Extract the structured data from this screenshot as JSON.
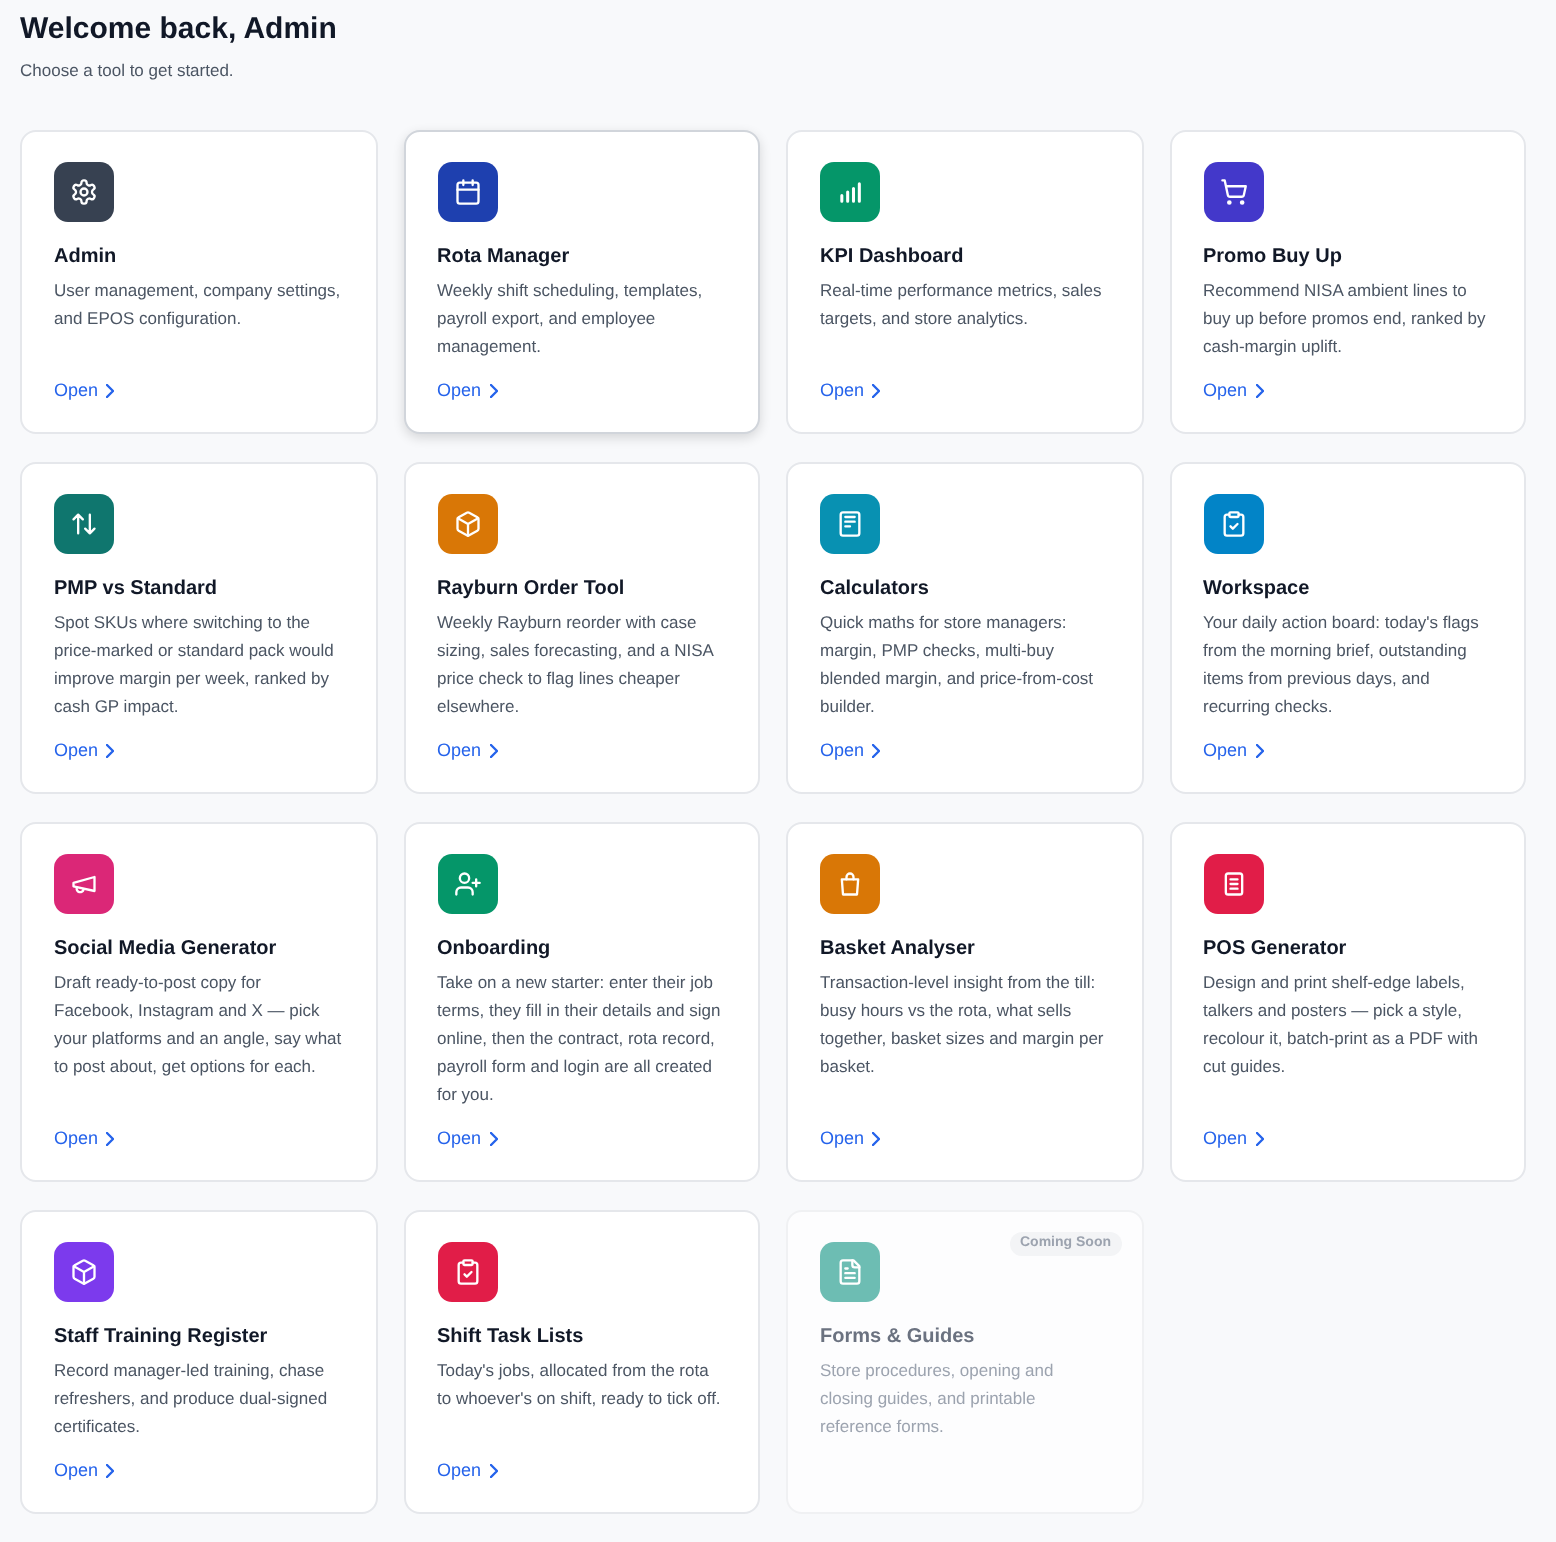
{
  "header": {
    "title": "Welcome back, Admin",
    "subtitle": "Choose a tool to get started."
  },
  "tools": [
    {
      "title": "Admin",
      "description": "User management, company settings, and EPOS configuration.",
      "link": "Open",
      "color": "#374151",
      "hovered": false,
      "disabled": false
    },
    {
      "title": "Rota Manager",
      "description": "Weekly shift scheduling, templates, payroll export, and employee management.",
      "link": "Open",
      "color": "#1e40af",
      "hovered": true,
      "disabled": false
    },
    {
      "title": "KPI Dashboard",
      "description": "Real-time performance metrics, sales targets, and store analytics.",
      "link": "Open",
      "color": "#059669",
      "hovered": false,
      "disabled": false
    },
    {
      "title": "Promo Buy Up",
      "description": "Recommend NISA ambient lines to buy up before promos end, ranked by cash-margin uplift.",
      "link": "Open",
      "color": "#4338ca",
      "hovered": false,
      "disabled": false
    },
    {
      "title": "PMP vs Standard",
      "description": "Spot SKUs where switching to the price-marked or standard pack would improve margin per week, ranked by cash GP impact.",
      "link": "Open",
      "color": "#0f766e",
      "hovered": false,
      "disabled": false
    },
    {
      "title": "Rayburn Order Tool",
      "description": "Weekly Rayburn reorder with case sizing, sales forecasting, and a NISA price check to flag lines cheaper elsewhere.",
      "link": "Open",
      "color": "#d97706",
      "hovered": false,
      "disabled": false
    },
    {
      "title": "Calculators",
      "description": "Quick maths for store managers: margin, PMP checks, multi-buy blended margin, and price-from-cost builder.",
      "link": "Open",
      "color": "#0891b2",
      "hovered": false,
      "disabled": false
    },
    {
      "title": "Workspace",
      "description": "Your daily action board: today's flags from the morning brief, outstanding items from previous days, and recurring checks.",
      "link": "Open",
      "color": "#0284c7",
      "hovered": false,
      "disabled": false
    },
    {
      "title": "Social Media Generator",
      "description": "Draft ready-to-post copy for Facebook, Instagram and X — pick your platforms and an angle, say what to post about, get options for each.",
      "link": "Open",
      "color": "#db2777",
      "hovered": false,
      "disabled": false
    },
    {
      "title": "Onboarding",
      "description": "Take on a new starter: enter their job terms, they fill in their details and sign online, then the contract, rota record, payroll form and login are all created for you.",
      "link": "Open",
      "color": "#059669",
      "hovered": false,
      "disabled": false
    },
    {
      "title": "Basket Analyser",
      "description": "Transaction-level insight from the till: busy hours vs the rota, what sells together, basket sizes and margin per basket.",
      "link": "Open",
      "color": "#d97706",
      "hovered": false,
      "disabled": false
    },
    {
      "title": "POS Generator",
      "description": "Design and print shelf-edge labels, talkers and posters — pick a style, recolour it, batch-print as a PDF with cut guides.",
      "link": "Open",
      "color": "#e11d48",
      "hovered": false,
      "disabled": false
    },
    {
      "title": "Staff Training Register",
      "description": "Record manager-led training, chase refreshers, and produce dual-signed certificates.",
      "link": "Open",
      "color": "#7c3aed",
      "hovered": false,
      "disabled": false
    },
    {
      "title": "Shift Task Lists",
      "description": "Today's jobs, allocated from the rota to whoever's on shift, ready to tick off.",
      "link": "Open",
      "color": "#e11d48",
      "hovered": false,
      "disabled": false
    },
    {
      "title": "Forms & Guides",
      "description": "Store procedures, opening and closing guides, and printable reference forms.",
      "badge": "Coming Soon",
      "color": "#6dbdb3",
      "hovered": false,
      "disabled": true
    }
  ]
}
